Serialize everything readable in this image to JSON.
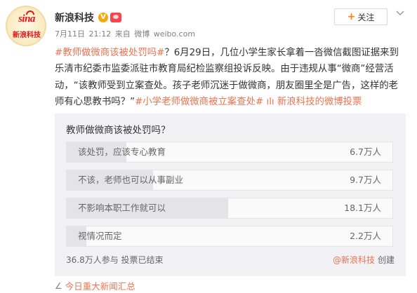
{
  "account": {
    "logo_top": "sina",
    "logo_bottom": "新浪科技",
    "name": "新浪科技",
    "verified_mark": "V"
  },
  "meta": {
    "date": "7月11日",
    "time": "21:12",
    "source": "来自",
    "client": "微博",
    "site": "weibo.com"
  },
  "follow": {
    "plus": "+",
    "label": "关注"
  },
  "post": {
    "hashtag1": "#教师做微商该被处罚吗#",
    "text1": "？6月29日，几位小学生家长拿着一沓微信截图证据来到乐清市纪委市监委派驻市教育局纪检监察组投诉反映。由于违规从事“微商”经营活动，“该教师受到立案查处。孩子老师沉迷于做微商，朋友圈里全是广告，这样的老师有心思教书吗？”",
    "hashtag2": "#小学老师做微商被立案查处#",
    "vote_icon": "ılı",
    "vote_link": "新浪科技的微博投票"
  },
  "poll": {
    "title": "教师做微商该被处罚吗？",
    "options": [
      {
        "label": "该处罚，应该专心教育",
        "count": "6.7万人",
        "share": 0.183
      },
      {
        "label": "不该，老师也可以从事副业",
        "count": "9.7万人",
        "share": 0.265
      },
      {
        "label": "不影响本职工作就可以",
        "count": "18.1万人",
        "share": 0.495
      },
      {
        "label": "视情况而定",
        "count": "2.2万人",
        "share": 0.06
      }
    ],
    "footer": "36.8万人参与  投票已结束",
    "creator": "@新浪科技",
    "creator_suffix": "创建"
  },
  "bottom_link": {
    "icon": "∠",
    "label": "今日重大新闻汇总"
  },
  "colors": {
    "link": "#eb7350",
    "accent_orange": "#ff8200",
    "verified": "#f7a80d",
    "brand_red": "#e3141c"
  },
  "icons": [
    "verified-v-icon",
    "vip-badge-icon",
    "plus-icon",
    "chevron-down-icon",
    "vote-chart-icon",
    "link-icon"
  ]
}
